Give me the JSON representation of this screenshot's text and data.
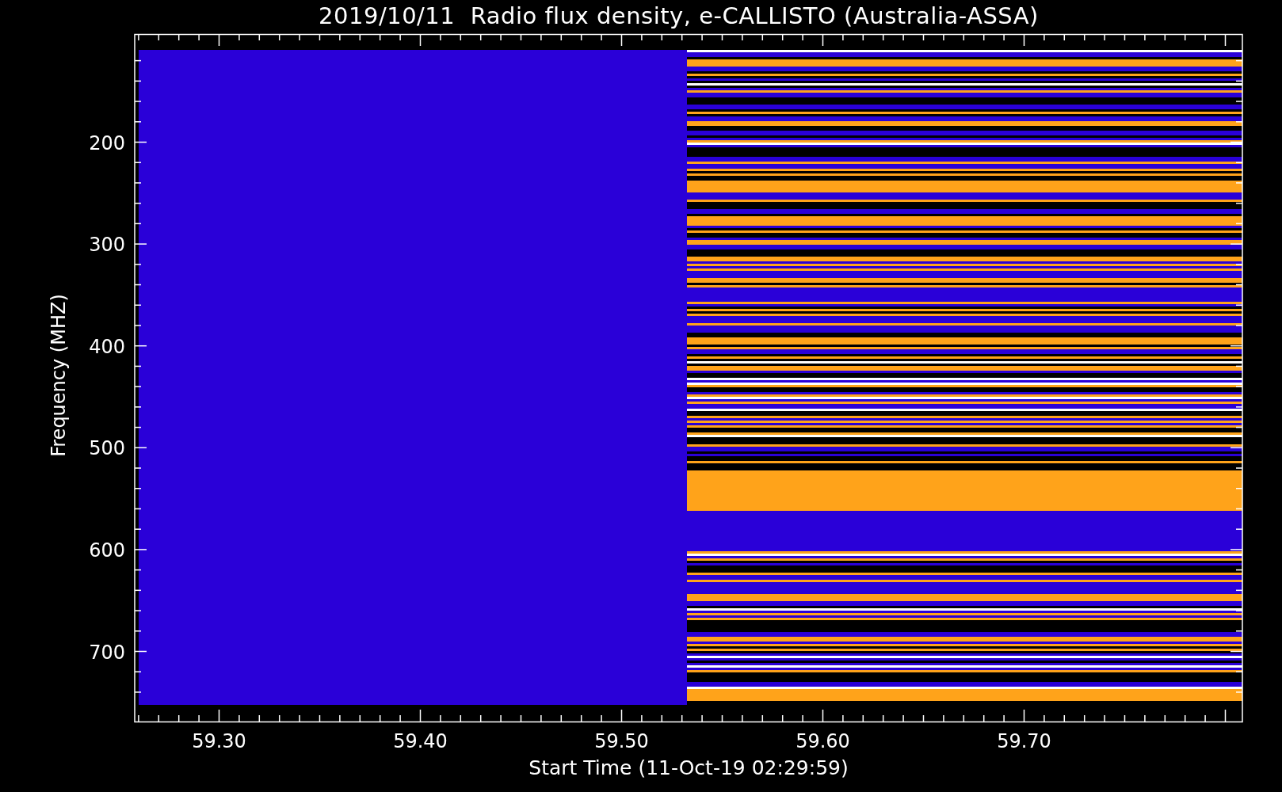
{
  "title": "2019/10/11  Radio flux density, e-CALLISTO (Australia-ASSA)",
  "y_axis": {
    "label": "Frequency (MHZ)",
    "ticks": [
      "200",
      "300",
      "400",
      "500",
      "600",
      "700"
    ]
  },
  "x_axis": {
    "label": "Start Time (11-Oct-19 02:29:59)",
    "ticks": [
      "59.30",
      "59.40",
      "59.50",
      "59.60",
      "59.70"
    ]
  }
}
